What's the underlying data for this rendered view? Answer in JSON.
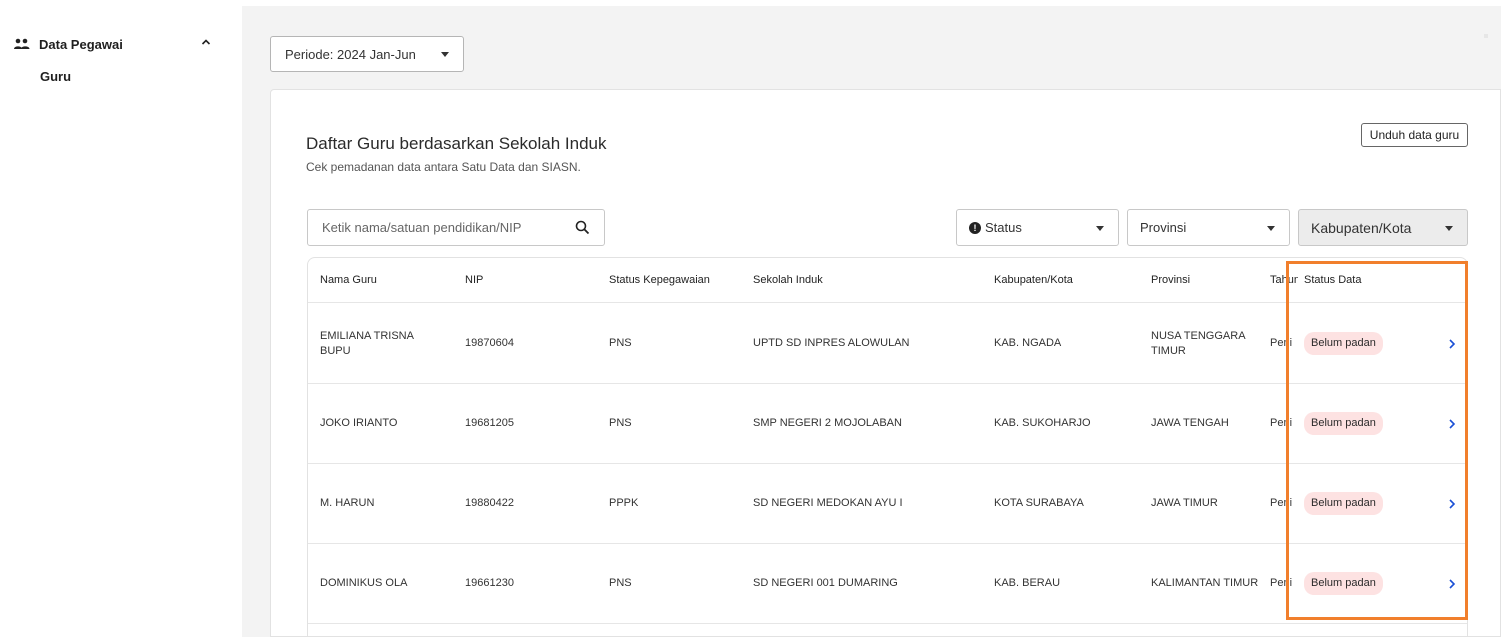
{
  "sidebar": {
    "group_label": "Data Pegawai",
    "sub_item": "Guru"
  },
  "filters": {
    "periode": "Periode: 2024 Jan-Jun",
    "search_placeholder": "Ketik nama/satuan pendidikan/NIP",
    "status_label": "Status",
    "provinsi_label": "Provinsi",
    "kabupaten_label": "Kabupaten/Kota"
  },
  "card": {
    "title": "Daftar Guru berdasarkan Sekolah Induk",
    "subtitle": "Cek pemadanan data antara Satu Data dan SIASN.",
    "download_label": "Unduh data guru"
  },
  "table": {
    "headers": {
      "nama": "Nama Guru",
      "nip": "NIP",
      "status_kepegawaian": "Status Kepegawaian",
      "sekolah_induk": "Sekolah Induk",
      "kabupaten": "Kabupaten/Kota",
      "provinsi": "Provinsi",
      "tahun": "Tahun",
      "status_data": "Status Data"
    },
    "rows": [
      {
        "nama": "EMILIANA TRISNA BUPU",
        "nip": "19870604",
        "status_kepegawaian": "PNS",
        "sekolah_induk": "UPTD SD INPRES ALOWULAN",
        "kabupaten": "KAB. NGADA",
        "provinsi": "NUSA TENGGARA TIMUR",
        "tahun": "Peni",
        "status_data": "Belum padan"
      },
      {
        "nama": "JOKO IRIANTO",
        "nip": "19681205",
        "status_kepegawaian": "PNS",
        "sekolah_induk": "SMP NEGERI 2 MOJOLABAN",
        "kabupaten": "KAB. SUKOHARJO",
        "provinsi": "JAWA TENGAH",
        "tahun": "Peni",
        "status_data": "Belum padan"
      },
      {
        "nama": "M. HARUN",
        "nip": "19880422",
        "status_kepegawaian": "PPPK",
        "sekolah_induk": "SD NEGERI MEDOKAN AYU I",
        "kabupaten": "KOTA SURABAYA",
        "provinsi": "JAWA TIMUR",
        "tahun": "Peni",
        "status_data": "Belum padan"
      },
      {
        "nama": "DOMINIKUS OLA",
        "nip": "19661230",
        "status_kepegawaian": "PNS",
        "sekolah_induk": "SD NEGERI 001 DUMARING",
        "kabupaten": "KAB. BERAU",
        "provinsi": "KALIMANTAN TIMUR",
        "tahun": "Peni",
        "status_data": "Belum padan"
      }
    ]
  },
  "colors": {
    "highlight": "#f17f2c",
    "badge_bg": "#fde2e2",
    "main_bg": "#f3f3f3"
  }
}
